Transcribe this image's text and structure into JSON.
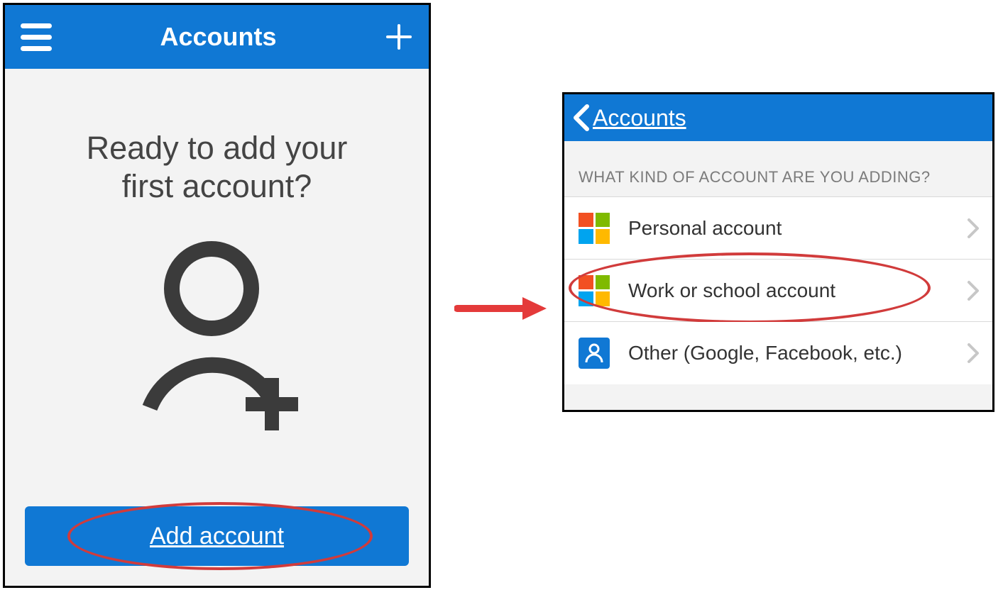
{
  "left": {
    "header_title": "Accounts",
    "prompt_line1": "Ready to add your",
    "prompt_line2": "first account?",
    "add_button_label": "Add account"
  },
  "right": {
    "back_label": "Accounts",
    "section_header": "WHAT KIND OF ACCOUNT ARE YOU ADDING?",
    "options": [
      {
        "label": "Personal account"
      },
      {
        "label": "Work or school account"
      },
      {
        "label": "Other (Google, Facebook, etc.)"
      }
    ]
  }
}
